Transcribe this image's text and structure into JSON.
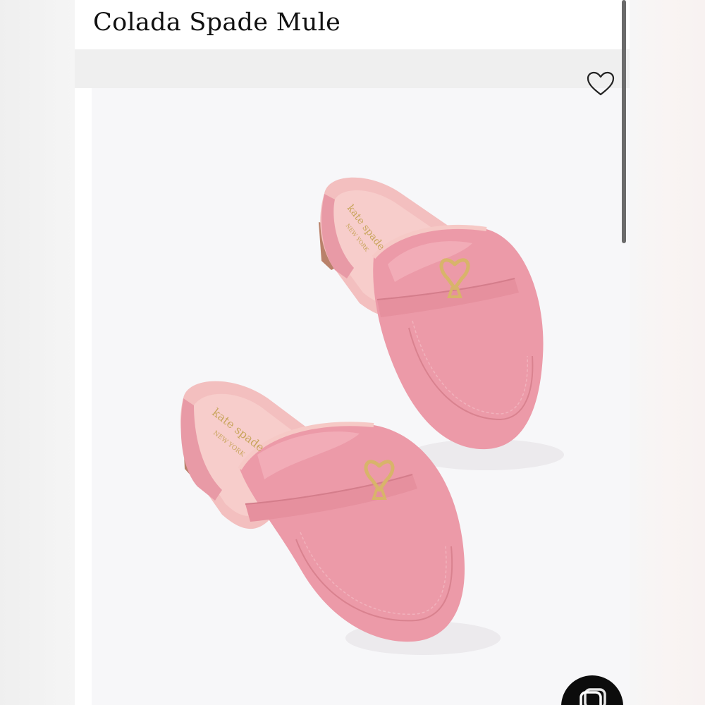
{
  "product": {
    "title": "Colada Spade Mule",
    "image_subject": "pink leather slip-on mule loafers",
    "brand_stamp_top": "kate spade",
    "brand_stamp_bottom": "NEW YORK",
    "shoe_color": "#ec9aa8",
    "lining_color": "#f6c9c6",
    "hardware_color": "#d8b46a"
  },
  "actions": {
    "favorite_icon": "heart-outline-icon",
    "chat_icon": "chat-bubble-icon"
  },
  "colors": {
    "page_bg": "#ffffff",
    "band_bg": "#efefef",
    "image_bg": "#f7f7f9",
    "title_text": "#111111"
  }
}
